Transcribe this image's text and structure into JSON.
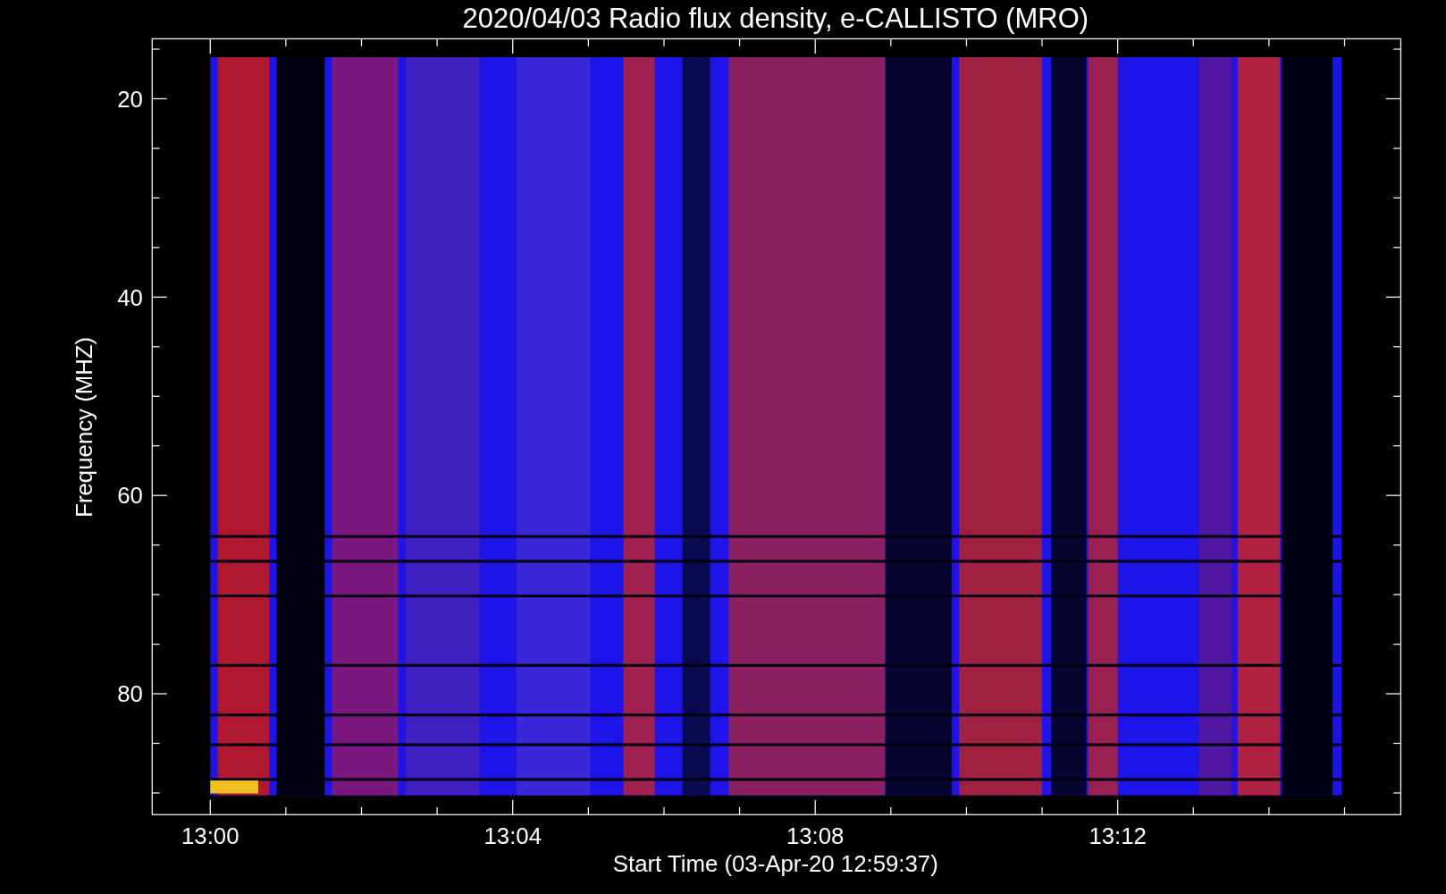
{
  "title": "2020/04/03  Radio flux density, e-CALLISTO (MRO)",
  "y_axis": {
    "label": "Frequency (MHZ)",
    "ticks": [
      "20",
      "40",
      "60",
      "80"
    ]
  },
  "x_axis": {
    "label": "Start Time (03-Apr-20 12:59:37)",
    "ticks": [
      "13:00",
      "13:04",
      "13:08",
      "13:12"
    ]
  }
}
